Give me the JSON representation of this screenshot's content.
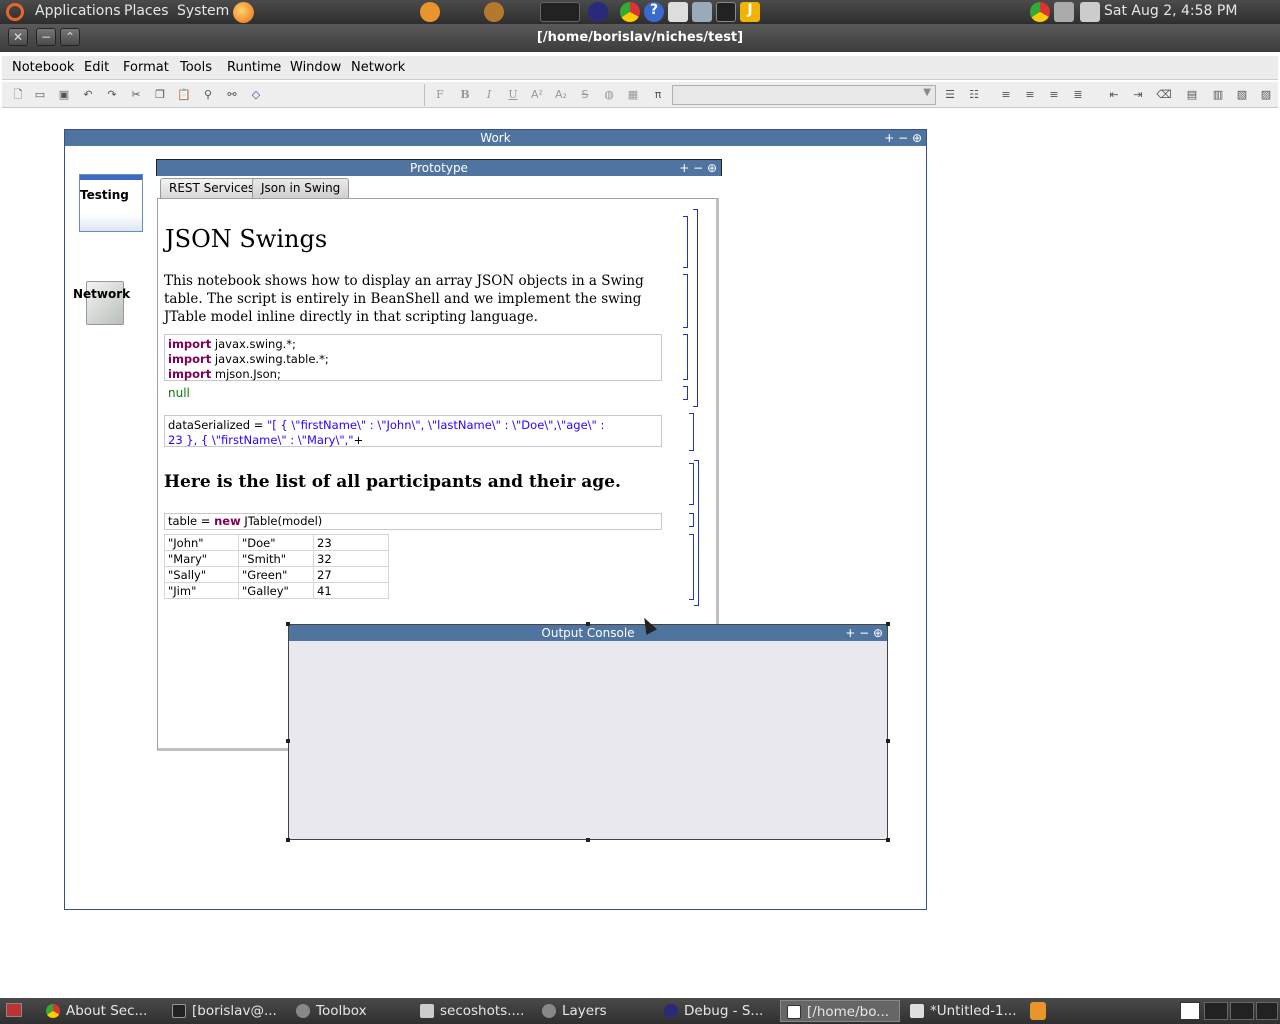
{
  "top_panel": {
    "menus": [
      "Applications",
      "Places",
      "System"
    ],
    "clock": "Sat Aug  2,  4:58 PM"
  },
  "window": {
    "title": "[/home/borislav/niches/test]"
  },
  "menubar": [
    "Notebook",
    "Edit",
    "Format",
    "Tools",
    "Runtime",
    "Window",
    "Network"
  ],
  "toolbar": {
    "format_buttons": [
      "F",
      "B",
      "I",
      "U",
      "A²",
      "A₂",
      "S",
      "π"
    ]
  },
  "work": {
    "title": "Work",
    "icons": [
      {
        "label": "Testing"
      },
      {
        "label": "Network"
      }
    ]
  },
  "prototype": {
    "title": "Prototype",
    "tabs": [
      "REST Services",
      "Json in Swing"
    ],
    "active_tab": "Json in Swing"
  },
  "notebook": {
    "heading": "JSON Swings",
    "paragraph": "This notebook shows how to display an array JSON objects in a Swing table. The script is entirely in BeanShell and we implement the swing JTable model inline directly in that scripting language.",
    "imports": [
      {
        "kw": "import",
        "rest": " javax.swing.*;"
      },
      {
        "kw": "import",
        "rest": " javax.swing.table.*;"
      },
      {
        "kw": "import",
        "rest": " mjson.Json;"
      }
    ],
    "null_output": "null",
    "data_cell_line1_prefix": "dataSerialized = ",
    "data_cell_line1_str": "\"[ { \\\"firstName\\\" : \\\"John\\\", \\\"lastName\\\"  : \\\"Doe\\\",\\\"age\\\" :",
    "data_cell_line2_str": "23 }, { \\\"firstName\\\" : \\\"Mary\\\",\"",
    "data_cell_line2_suffix": "+",
    "subheading": "Here is the list of all participants and their age.",
    "table_cell_prefix": "table = ",
    "table_cell_kw": "new",
    "table_cell_suffix": " JTable(model)",
    "rows": [
      [
        "\"John\"",
        "\"Doe\"",
        "23"
      ],
      [
        "\"Mary\"",
        "\"Smith\"",
        "32"
      ],
      [
        "\"Sally\"",
        "\"Green\"",
        "27"
      ],
      [
        "\"Jim\"",
        "\"Galley\"",
        "41"
      ]
    ]
  },
  "console": {
    "title": "Output Console"
  },
  "frame_controls": "+ − ⊕",
  "taskbar": [
    {
      "label": "About Sec...",
      "active": false
    },
    {
      "label": "[borislav@...",
      "active": false
    },
    {
      "label": "Toolbox",
      "active": false
    },
    {
      "label": "secoshots....",
      "active": false
    },
    {
      "label": "Layers",
      "active": false
    },
    {
      "label": "Debug - S...",
      "active": false
    },
    {
      "label": "[/home/bo...",
      "active": true
    },
    {
      "label": "*Untitled-1...",
      "active": false
    }
  ]
}
